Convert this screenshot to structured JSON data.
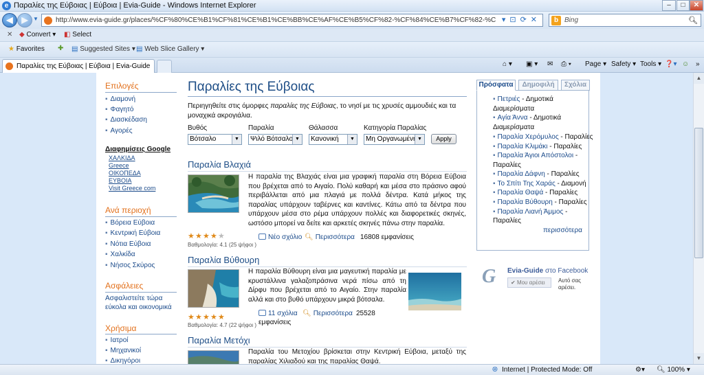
{
  "window": {
    "title": "Παραλίες της Εύβοιας | Εύβοια | Evia-Guide - Windows Internet Explorer",
    "minimize": "–",
    "maximize": "□",
    "close": "✕"
  },
  "address_bar": {
    "url": "http://www.evia-guide.gr/places/%CF%80%CE%B1%CF%81%CE%B1%CE%BB%CE%AF%CE%B5%CF%82-%CF%84%CE%B7%CF%82-%CE%B5%CF%8D%CE%B2%CE%BF%CE%B9%CE%B1%CF%82/",
    "search_placeholder": "Bing"
  },
  "command_bar": {
    "convert": "Convert",
    "select": "Select"
  },
  "favorites_bar": {
    "favorites": "Favorites",
    "suggested": "Suggested Sites",
    "webslice": "Web Slice Gallery"
  },
  "tabs": [
    {
      "label": "Παραλίες της Εύβοιας | Εύβοια | Evia-Guide"
    }
  ],
  "tab_tools": {
    "page": "Page",
    "safety": "Safety",
    "tools": "Tools"
  },
  "status": {
    "zone": "Internet | Protected Mode: Off",
    "zoom": "100%"
  },
  "left_nav": {
    "options_title": "Επιλογές",
    "options": [
      "Διαμονή",
      "Φαγητό",
      "Διασκέδαση",
      "Αγορές"
    ],
    "ads_title": "Διαφημίσεις Google",
    "ads": [
      "ΧΑΛΚΙΔΑ",
      "Greece",
      "ΟΙΚΟΠΕΔΑ",
      "ΕΥΒΟΙΑ",
      "Visit Greece com"
    ],
    "region_title": "Ανά περιοχή",
    "regions": [
      "Βόρεια Εύβοια",
      "Κεντρική Εύβοια",
      "Νότια Εύβοια",
      "Χαλκίδα",
      "Νήσος Σκύρος"
    ],
    "insurance_title": "Ασφάλειες",
    "insurance_text": [
      "Ασφαλιστείτε τώρα",
      "εύκολα και οικονομικά"
    ],
    "useful_title": "Χρήσιμα",
    "useful": [
      "Ιατροί",
      "Μηχανικοί",
      "Δικηγόροι"
    ]
  },
  "main": {
    "title": "Παραλίες της Εύβοιας",
    "intro_a": "Περιηγηθείτε στις όμορφες ",
    "intro_em": "παραλίες της Εύβοιας",
    "intro_b": ", το νησί με τις χρυσές αμμουδιές και τα μοναχικά ακρογιάλια.",
    "filters": [
      {
        "label": "Βυθός",
        "value": "Βότσαλο"
      },
      {
        "label": "Παραλία",
        "value": "Ψιλό Βότσαλο"
      },
      {
        "label": "Θάλασσα",
        "value": "Κανονική"
      },
      {
        "label": "Κατηγορία Παραλίας",
        "value": "Μη Οργανωμένη"
      }
    ],
    "apply": "Apply",
    "beaches": [
      {
        "title": "Παραλία Βλαχιά",
        "desc": "Η παραλία της Βλαχιάς είναι μια γραφική παραλία στη Βόρεια Εύβοια που βρέχεται από το Αιγαίο. Πολύ καθαρή και μέσα στο πράσινο αφού περιβάλλεται από μια πλαγιά με πολλά δέντρα. Κατά μήκος της παραλίας υπάρχουν ταβέρνες και καντίνες. Κάτω από τα δέντρα που υπάρχουν μέσα στο ρέμα υπάρχουν πολλές και διαφορετικές σκηνές, ωστόσο μπορεί να δείτε και αρκετές σκηνές πάνω στην παραλία.",
        "rating": 4.1,
        "rating_text": "Βαθμολογία: 4.1 (25 ψήφοι )",
        "comments": "Νέο σχόλιο",
        "more": "Περισσότερα",
        "views": "16808 εμφανίσεις"
      },
      {
        "title": "Παραλία Βύθουρη",
        "desc": "Η παραλία Βύθουρη είναι μια μαγευτική παραλία με κρυστάλλινα γαλαζοπράσινα νερά πίσω από τη Δίρφυ που βρέχεται από το Αιγαίο. Στην παραλία αλλά και στο βυθό υπάρχουν μικρά βότσαλα.",
        "rating": 4.7,
        "rating_text": "Βαθμολογία: 4.7 (22 ψήφοι )",
        "comments": "11 σχόλια",
        "more": "Περισσότερα",
        "views_num": "25528",
        "views_word": "εμφανίσεις"
      },
      {
        "title": "Παραλία Μετόχι",
        "desc": "Παραλία του Μετοχίου βρίσκεται στην Κεντρική Εύβοια, μεταξύ της παραλίας Χιλιαδού και της παραλίας Θαψά."
      }
    ]
  },
  "right": {
    "tabs": [
      "Πρόσφατα",
      "Δημοφιλή",
      "Σχόλια"
    ],
    "recent": [
      {
        "link": "Πετριές",
        "rest": " - Δημοτικά"
      },
      {
        "link": "",
        "rest": "Διαμερίσματα"
      },
      {
        "link": "Αγία Άννα",
        "rest": " - Δημοτικά"
      },
      {
        "link": "",
        "rest": "Διαμερίσματα"
      },
      {
        "link": "Παραλία Χερόμυλος",
        "rest": " - Παραλίες"
      },
      {
        "link": "Παραλία Κλιμάκι",
        "rest": " - Παραλίες"
      },
      {
        "link": "Παραλία Άγιοι Απόστολοι",
        "rest": " -"
      },
      {
        "link": "",
        "rest": "Παραλίες"
      },
      {
        "link": "Παραλία Δάφνη",
        "rest": " - Παραλίες"
      },
      {
        "link": "Το Σπίτι Της Χαράς",
        "rest": " - Διαμονή"
      },
      {
        "link": "Παραλία Θαψά",
        "rest": " - Παραλίες"
      },
      {
        "link": "Παραλία Βύθουρη",
        "rest": " - Παραλίες"
      },
      {
        "link": "Παραλία Λιανή Άμμος",
        "rest": " -"
      },
      {
        "link": "",
        "rest": "Παραλίες"
      }
    ],
    "more": "περισσότερα",
    "fb_name": "Evia-Guide",
    "fb_on": " στο Facebook",
    "fb_like": "Μου αρέσει",
    "fb_text": "Αυτό σας αρέσει."
  }
}
